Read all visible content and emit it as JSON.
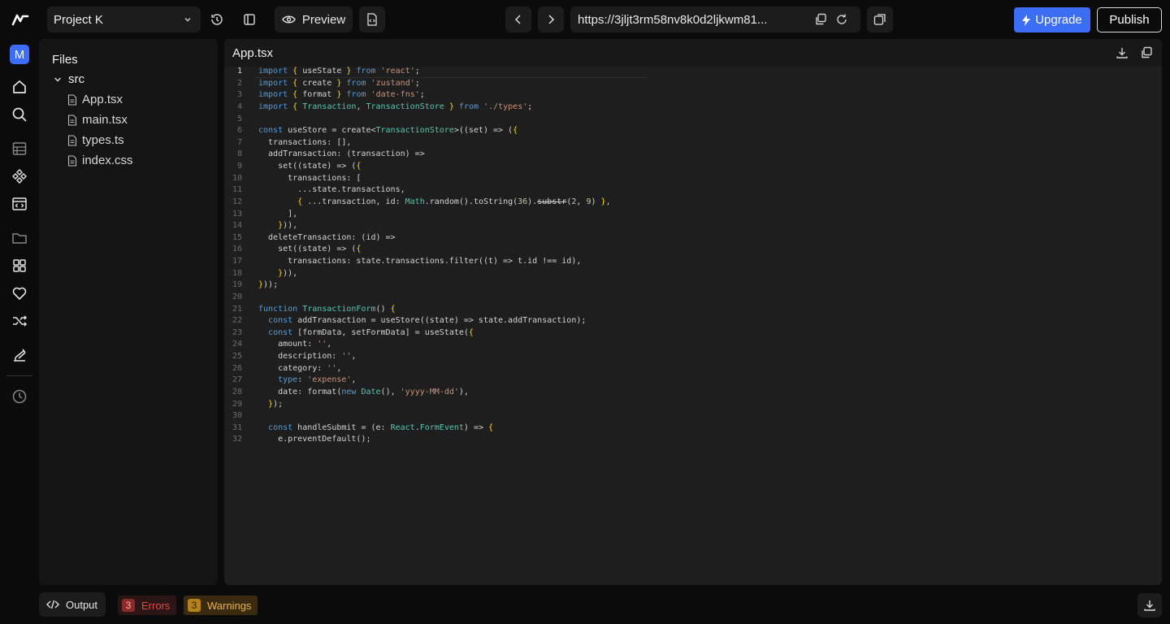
{
  "topbar": {
    "project_name": "Project K",
    "preview_label": "Preview",
    "url": "https://3jljt3rm58nv8k0d2ljkwm81...",
    "upgrade_label": "Upgrade",
    "publish_label": "Publish"
  },
  "rail": {
    "avatar_letter": "M"
  },
  "files": {
    "title": "Files",
    "folder": "src",
    "items": [
      "App.tsx",
      "main.tsx",
      "types.ts",
      "index.css"
    ]
  },
  "editor": {
    "filename": "App.tsx",
    "line_numbers": [
      "1",
      "2",
      "3",
      "4",
      "5",
      "6",
      "7",
      "8",
      "9",
      "10",
      "11",
      "12",
      "13",
      "14",
      "15",
      "16",
      "17",
      "18",
      "19",
      "20",
      "21",
      "22",
      "23",
      "24",
      "25",
      "26",
      "27",
      "28",
      "29",
      "30",
      "31",
      "32"
    ],
    "lines": [
      "import { useState } from 'react';",
      "import { create } from 'zustand';",
      "import { format } from 'date-fns';",
      "import { Transaction, TransactionStore } from './types';",
      "",
      "const useStore = create<TransactionStore>((set) => ({",
      "  transactions: [],",
      "  addTransaction: (transaction) =>",
      "    set((state) => ({",
      "      transactions: [",
      "        ...state.transactions,",
      "        { ...transaction, id: Math.random().toString(36).substr(2, 9) },",
      "      ],",
      "    })),",
      "  deleteTransaction: (id) =>",
      "    set((state) => ({",
      "      transactions: state.transactions.filter((t) => t.id !== id),",
      "    })),",
      "}));",
      "",
      "function TransactionForm() {",
      "  const addTransaction = useStore((state) => state.addTransaction);",
      "  const [formData, setFormData] = useState({",
      "    amount: '',",
      "    description: '',",
      "    category: '',",
      "    type: 'expense',",
      "    date: format(new Date(), 'yyyy-MM-dd'),",
      "  });",
      "",
      "  const handleSubmit = (e: React.FormEvent) => {",
      "    e.preventDefault();"
    ]
  },
  "bottom": {
    "output_label": "Output",
    "errors_count": "3",
    "errors_label": "Errors",
    "warnings_count": "3",
    "warnings_label": "Warnings"
  }
}
